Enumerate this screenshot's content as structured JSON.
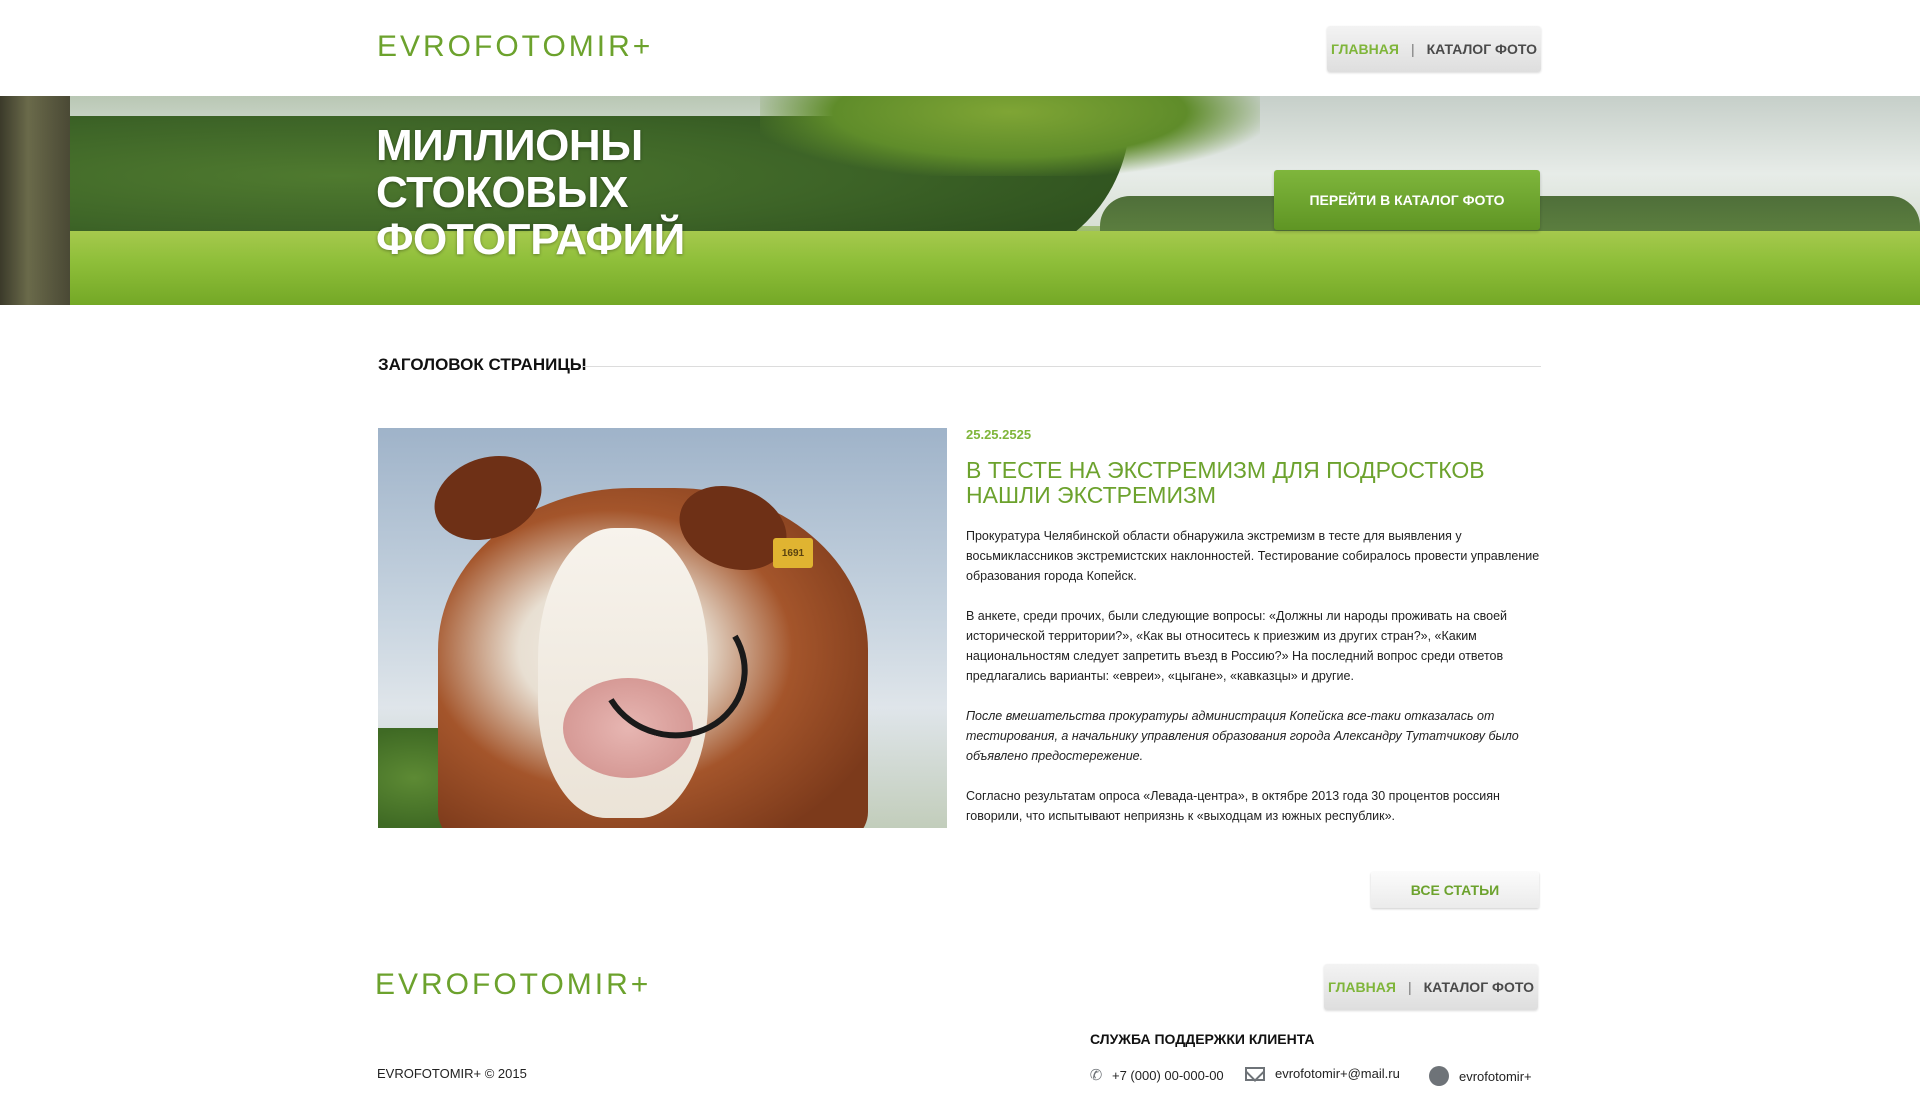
{
  "header": {
    "logo": "EVROFOTOMIR+",
    "nav": {
      "home": "ГЛАВНАЯ",
      "separator": "|",
      "catalog": "КАТАЛОГ ФОТО"
    }
  },
  "hero": {
    "title": "МИЛЛИОНЫ СТОКОВЫХ ФОТОГРАФИЙ",
    "cta": "ПЕРЕЙТИ В КАТАЛОГ ФОТО"
  },
  "page": {
    "heading": "ЗАГОЛОВОК СТРАНИЦЫ"
  },
  "article": {
    "date": "25.25.2525",
    "title": "В ТЕСТЕ НА ЭКСТРЕМИЗМ ДЛЯ ПОДРОСТКОВ НАШЛИ ЭКСТРЕМИЗМ",
    "image_tag": "1691",
    "paragraphs": [
      "Прокуратура Челябинской области обнаружила экстремизм в тесте для выявления у восьмиклассников экстремистских наклонностей. Тестирование собиралось провести управление образования города Копейск.",
      "В анкете, среди прочих, были следующие вопросы: «Должны ли народы проживать на своей исторической территории?», «Как вы относитесь к приезжим из других стран?», «Каким национальностям следует запретить въезд в Россию?» На последний вопрос среди ответов предлагались варианты: «евреи», «цыгане», «кавказцы» и другие.",
      "После вмешательства прокуратуры администрация Копейска все-таки отказалась от тестирования, а начальнику управления образования города Александру Тутатчикову было объявлено предостережение.",
      "Согласно результатам опроса «Левада-центра», в октябре 2013 года 30 процентов россиян говорили, что испытывают неприязнь к «выходцам из южных республик»."
    ],
    "all_articles": "ВСЕ СТАТЬИ"
  },
  "footer": {
    "logo": "EVROFOTOMIR+",
    "nav": {
      "home": "ГЛАВНАЯ",
      "separator": "|",
      "catalog": "КАТАЛОГ ФОТО"
    },
    "copyright": "EVROFOTOMIR+ © 2015",
    "support_title": "СЛУЖБА ПОДДЕРЖКИ КЛИЕНТА",
    "phone": "+7 (000) 00-000-00",
    "email": "evrofotomir+@mail.ru",
    "twitter": "evrofotomir+"
  },
  "icons": {
    "phone": "phone-icon",
    "mail": "mail-icon",
    "twitter": "twitter-icon"
  },
  "colors": {
    "accent": "#6ca22d",
    "accent_light": "#7fb53a",
    "button_green": "#6fa52f",
    "text": "#222222"
  }
}
